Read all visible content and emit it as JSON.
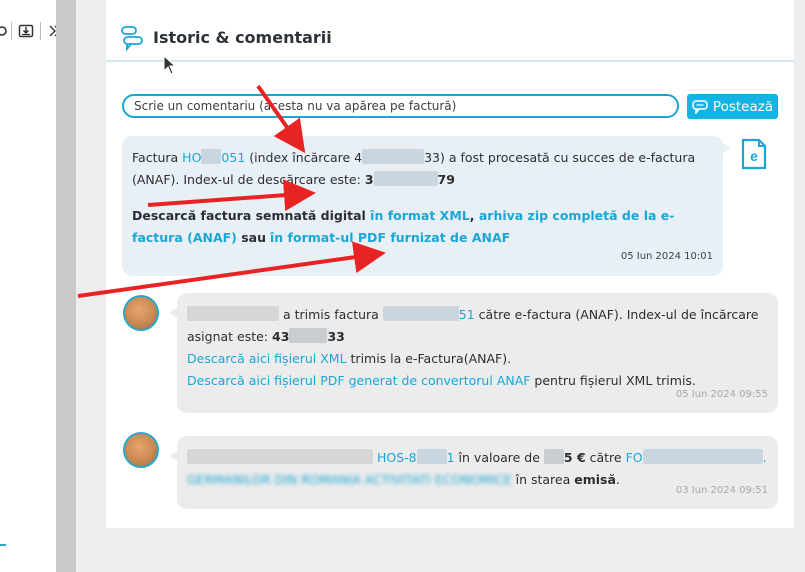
{
  "left_toolbar": {
    "icons": [
      "partial-icon",
      "download-box-icon",
      "double-chevron-right-icon"
    ]
  },
  "history": {
    "title": "Istoric & comentarii"
  },
  "composer": {
    "placeholder": "Scrie un comentariu (acesta nu va apărea pe factură)",
    "post_label": "Postează"
  },
  "system_message": {
    "p1_a": "Factura ",
    "invoice_prefix": "HO",
    "invoice_suffix": "051",
    "p1_b": " (index încărcare 4",
    "p1_c": "33) a fost procesată cu succes de e-factura (ANAF). Index-ul de descărcare este: ",
    "download_index_prefix": "3",
    "download_index_suffix": "79",
    "p2_a": "Descarcă factura semnată digital ",
    "link_xml": "în format XML",
    "p2_sep": ", ",
    "link_zip": "arhiva zip completă de la e-factura (ANAF)",
    "p2_b": " sau",
    "link_pdf": "în format-ul PDF furnizat de ANAF",
    "timestamp": "05 Iun 2024 10:01"
  },
  "messages": [
    {
      "text_a": " a trimis factura ",
      "invoice_suffix": "51",
      "text_b": " către e-factura (ANAF). Index-ul de încărcare asignat este: ",
      "upload_index_prefix": "43",
      "upload_index_suffix": "33",
      "link_xml": "Descarcă aici fișierul XML",
      "after_xml": " trimis la e-Factura(ANAF).",
      "link_pdf": "Descarcă aici fișierul PDF generat de convertorul ANAF",
      "after_pdf": " pentru fișierul XML trimis.",
      "timestamp": "05 Iun 2024 09:55"
    },
    {
      "invoice_prefix": "HOS-8",
      "invoice_suffix": "1",
      "text_a": " în valoare de ",
      "amount_suffix": "5 €",
      "text_b": " către ",
      "company_prefix": "FO",
      "company_suffix": ".",
      "company_line2_prefix": "GERMANILOR DIN ROMANIA ACTIVITATI ECONOMICE",
      "text_c": " în starea ",
      "status": "emisă",
      "text_d": ".",
      "timestamp": "03 Iun 2024 09:51"
    }
  ],
  "colors": {
    "accent": "#13b4e3",
    "link": "#1aa6d8",
    "annotation_arrow": "#e82323"
  }
}
